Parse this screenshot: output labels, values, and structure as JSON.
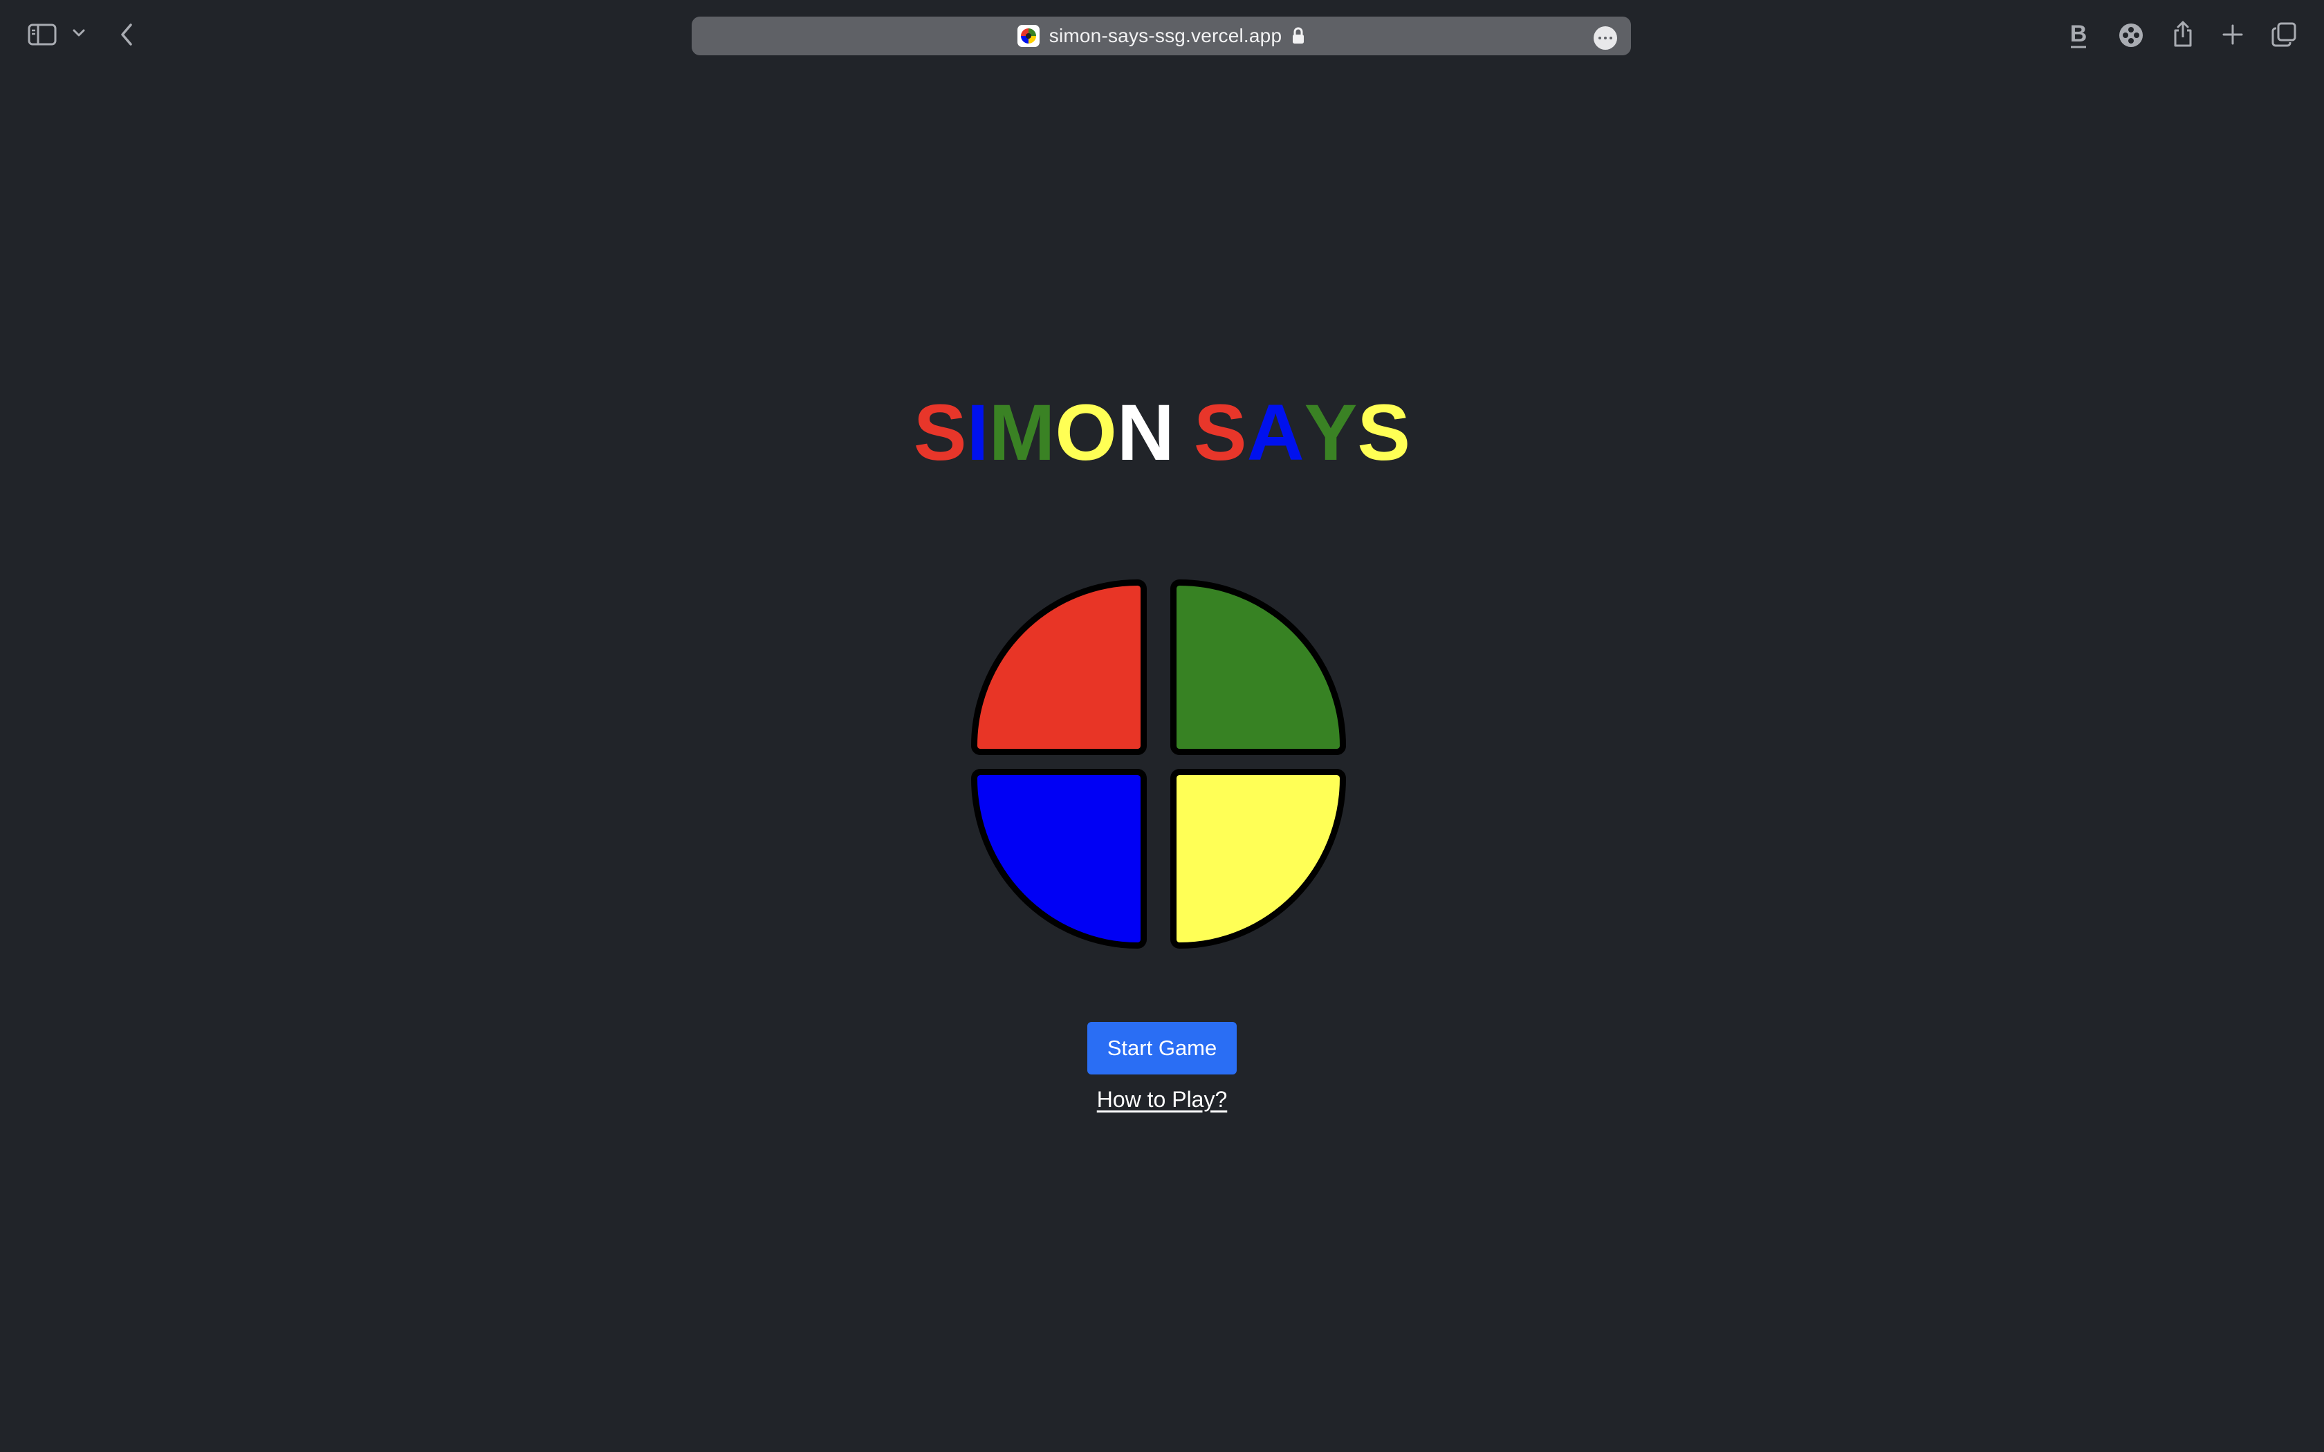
{
  "browser": {
    "url": "simon-says-ssg.vercel.app",
    "icons": {
      "sidebar": "sidebar-icon",
      "sidebar_menu": "chevron-down-icon",
      "back": "chevron-left-icon",
      "lock": "lock-icon",
      "more": "ellipsis-icon",
      "extension_b": "bold-b-icon",
      "extension_game": "gamepad-icon",
      "share": "share-icon",
      "new_tab": "plus-icon",
      "tab_overview": "tabs-icon"
    }
  },
  "game": {
    "title_letters": [
      {
        "char": "S",
        "color": "#e8362a"
      },
      {
        "char": "I",
        "color": "#0011ee"
      },
      {
        "char": "M",
        "color": "#3a8224"
      },
      {
        "char": "O",
        "color": "#ffff55"
      },
      {
        "char": "N",
        "color": "#ffffff"
      },
      {
        "char": " ",
        "color": "#ffffff"
      },
      {
        "char": "S",
        "color": "#e8362a"
      },
      {
        "char": "A",
        "color": "#0011ee"
      },
      {
        "char": "Y",
        "color": "#3a8224"
      },
      {
        "char": "S",
        "color": "#ffff55"
      }
    ],
    "pads": {
      "red": "#e83526",
      "green": "#378223",
      "blue": "#0000f5",
      "yellow": "#ffff56"
    },
    "start_button_label": "Start Game",
    "how_to_play_label": "How to Play?"
  },
  "colors": {
    "background": "#212429",
    "button": "#2a6ef4"
  }
}
